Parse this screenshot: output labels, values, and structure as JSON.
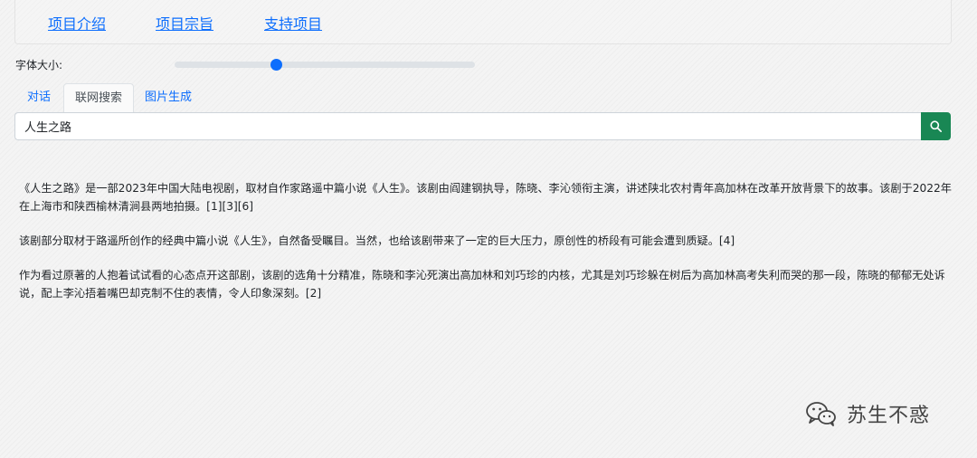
{
  "nav": {
    "items": [
      "项目介绍",
      "项目宗旨",
      "支持项目"
    ]
  },
  "font_size": {
    "label": "字体大小:",
    "value_fraction": 0.34
  },
  "tabs": [
    {
      "label": "对话",
      "active": false
    },
    {
      "label": "联网搜索",
      "active": true
    },
    {
      "label": "图片生成",
      "active": false
    }
  ],
  "search": {
    "value": "人生之路",
    "button_icon": "search-icon"
  },
  "results": {
    "paragraphs": [
      "《人生之路》是一部2023年中国大陆电视剧，取材自作家路遥中篇小说《人生》。该剧由阎建钢执导，陈晓、李沁领衔主演，讲述陕北农村青年高加林在改革开放背景下的故事。该剧于2022年在上海市和陕西榆林清涧县两地拍摄。[1][3][6]",
      "该剧部分取材于路遥所创作的经典中篇小说《人生》，自然备受瞩目。当然，也给该剧带来了一定的巨大压力，原创性的桥段有可能会遭到质疑。[4]",
      "作为看过原著的人抱着试试看的心态点开这部剧，该剧的选角十分精准，陈晓和李沁死演出高加林和刘巧珍的内核，尤其是刘巧珍躲在树后为高加林高考失利而哭的那一段，陈晓的郁郁无处诉说，配上李沁捂着嘴巴却克制不住的表情，令人印象深刻。[2]"
    ]
  },
  "watermark": {
    "text": "苏生不惑",
    "icon": "wechat-icon"
  },
  "colors": {
    "link": "#0d6efd",
    "search_button": "#198754",
    "slider_track": "#dee2e6"
  }
}
